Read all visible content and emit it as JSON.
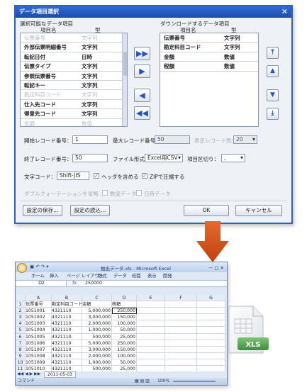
{
  "dialog": {
    "title": "データ項目選択",
    "close": "✕",
    "available_label": "選択可能なデータ項目",
    "export_label": "ダウンロードするデータ項目",
    "col_name": "項目名",
    "col_type": "型",
    "available_items": [
      {
        "name": "伝票番号",
        "type": "文字列",
        "dim": true
      },
      {
        "name": "外部伝票明細番号",
        "type": "文字列",
        "dim": false
      },
      {
        "name": "転記日付",
        "type": "日時",
        "dim": false
      },
      {
        "name": "伝票タイプ",
        "type": "文字列",
        "dim": false
      },
      {
        "name": "参照伝票番号",
        "type": "文字列",
        "dim": false
      },
      {
        "name": "転記キー",
        "type": "文字列",
        "dim": false
      },
      {
        "name": "勘定科目コード",
        "type": "文字列",
        "dim": true
      },
      {
        "name": "仕入先コード",
        "type": "文字列",
        "dim": false
      },
      {
        "name": "得意先コード",
        "type": "文字列",
        "dim": false
      },
      {
        "name": "金額",
        "type": "数値",
        "dim": true
      }
    ],
    "export_items": [
      {
        "name": "伝票番号",
        "type": "文字列"
      },
      {
        "name": "勘定科目コード",
        "type": "文字列"
      },
      {
        "name": "金額",
        "type": "数値"
      },
      {
        "name": "税額",
        "type": "数値"
      }
    ],
    "arrows": {
      "add_all": "▶▶",
      "add": "▶",
      "remove": "◀",
      "remove_all": "◀◀"
    },
    "order": {
      "top": "⤒",
      "up": "▲",
      "down": "▼",
      "bottom": "⤓"
    },
    "start_record_label": "開始レコード番号：",
    "start_record_value": "1",
    "max_record_label": "最大レコード番号：",
    "max_record_value": "50",
    "display_record_label": "表示レコード数：",
    "display_record_value": "20",
    "end_record_label": "終了レコード番号：",
    "end_record_value": "50",
    "file_format_label": "ファイル形式：",
    "file_format_value": "Excel用CSV",
    "delimiter_label": "項目区切り：",
    "delimiter_value": ",",
    "charset_label": "文字コード：",
    "charset_value": "Shift-JIS",
    "include_header_label": "ヘッダを含める",
    "zip_label": "ZIPで圧縮する",
    "double_quote_label": "ダブルクォーテーションを省略",
    "numeric_data_label": "数値データ",
    "date_data_label": "日時データ",
    "save_settings": "設定の保存…",
    "load_settings": "設定の読込…",
    "ok": "OK",
    "cancel": "キャンセル"
  },
  "excel": {
    "title": "抽出データ.xls - Microsoft Excel",
    "window_controls": "－ □ ✕",
    "ribbon_tabs": [
      "ホーム",
      "挿入",
      "ページ レイアウト",
      "数式",
      "データ",
      "校閲",
      "表示",
      "開発"
    ],
    "name_box": "D2",
    "fx": "fx",
    "formula_value": "250000",
    "col_letters": [
      "A",
      "B",
      "C",
      "D",
      "E",
      "F",
      "G"
    ],
    "headers": [
      "伝票番号",
      "勘定科目コード",
      "金額",
      "税額"
    ],
    "rows": [
      [
        "1051001",
        "4321110",
        "5,000,000",
        "250,000"
      ],
      [
        "1051002",
        "4321110",
        "3,000,000",
        "150,000"
      ],
      [
        "1051003",
        "4321110",
        "2,000,000",
        "100,000"
      ],
      [
        "1051004",
        "4321110",
        "1,000,000",
        "50,000"
      ],
      [
        "1051005",
        "4321110",
        "500,000",
        "25,000"
      ],
      [
        "1051006",
        "4321110",
        "5,000,000",
        "250,000"
      ],
      [
        "1051007",
        "4321110",
        "3,000,000",
        "150,000"
      ],
      [
        "1051008",
        "4321110",
        "2,000,000",
        "100,000"
      ],
      [
        "1051009",
        "4321110",
        "1,000,000",
        "50,000"
      ],
      [
        "1051010",
        "4321110",
        "500,000",
        "25,000"
      ]
    ],
    "sheet_tab": "2011-05-03",
    "status": "コマンド",
    "zoom": "100%"
  },
  "file_icon_label": "XLS"
}
